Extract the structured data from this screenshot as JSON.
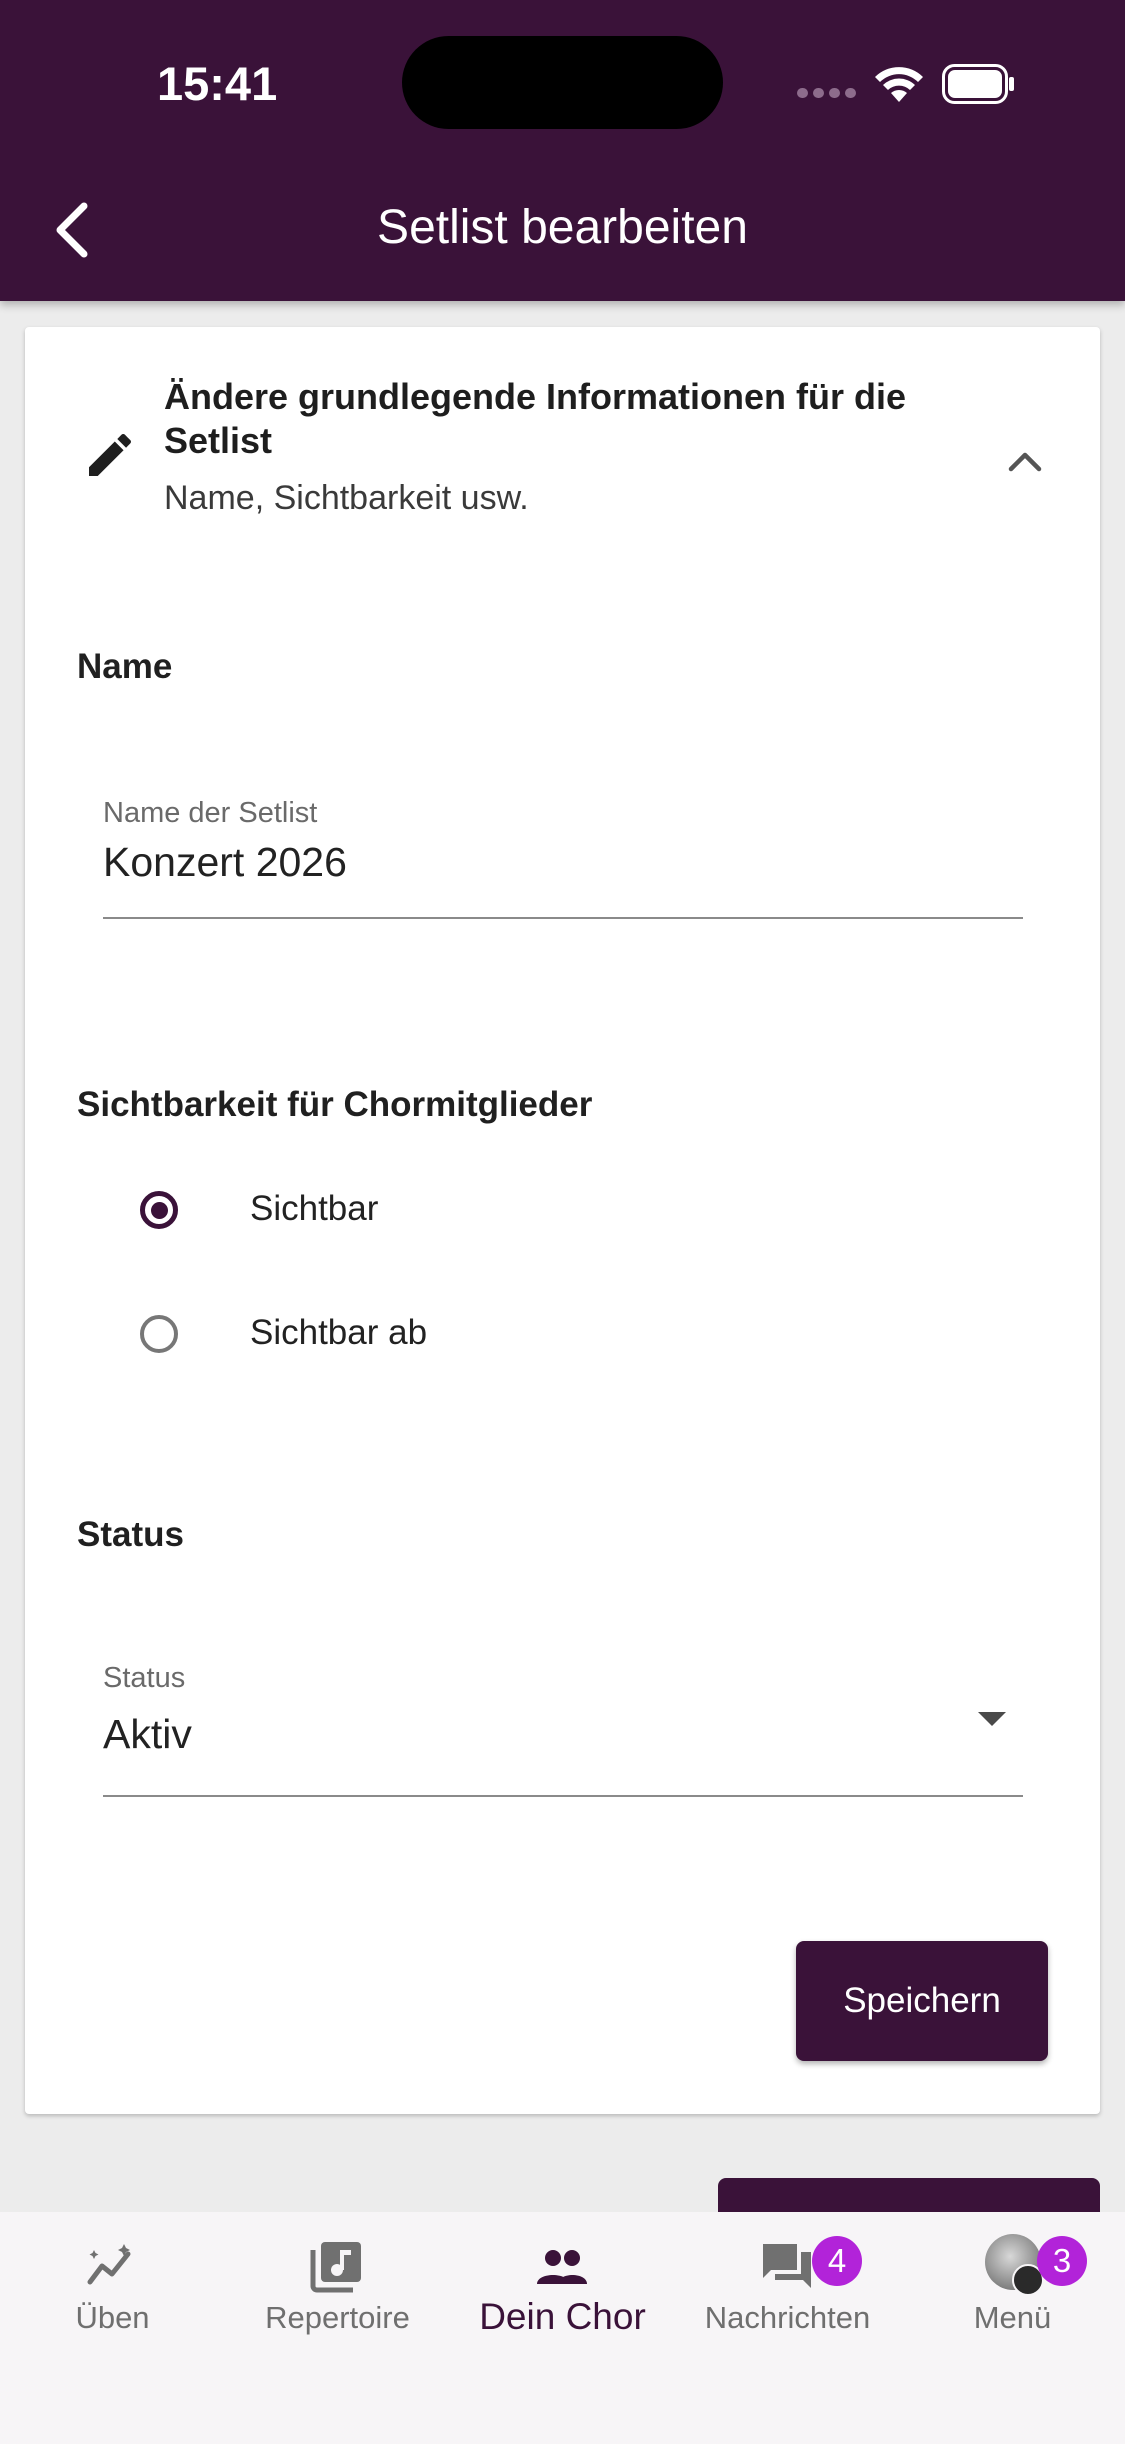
{
  "status_bar": {
    "time": "15:41"
  },
  "header": {
    "title": "Setlist bearbeiten"
  },
  "card": {
    "title": "Ändere grundlegende Informationen für die Setlist",
    "subtitle": "Name, Sichtbarkeit usw."
  },
  "name_section": {
    "label": "Name",
    "field_label": "Name der Setlist",
    "value": "Konzert 2026"
  },
  "visibility_section": {
    "label": "Sichtbarkeit für Chormitglieder",
    "options": [
      {
        "label": "Sichtbar",
        "selected": true
      },
      {
        "label": "Sichtbar ab",
        "selected": false
      }
    ]
  },
  "status_section": {
    "label": "Status",
    "field_label": "Status",
    "value": "Aktiv"
  },
  "actions": {
    "save_label": "Speichern"
  },
  "bottom_nav": {
    "items": [
      {
        "label": "Üben",
        "icon": "trend-icon"
      },
      {
        "label": "Repertoire",
        "icon": "music-library-icon"
      },
      {
        "label": "Dein Chor",
        "icon": "group-icon",
        "active": true
      },
      {
        "label": "Nachrichten",
        "icon": "chat-icon",
        "badge": "4"
      },
      {
        "label": "Menü",
        "icon": "avatar",
        "badge": "3"
      }
    ]
  },
  "colors": {
    "primary": "#3a1239",
    "badge": "#b223d9"
  }
}
